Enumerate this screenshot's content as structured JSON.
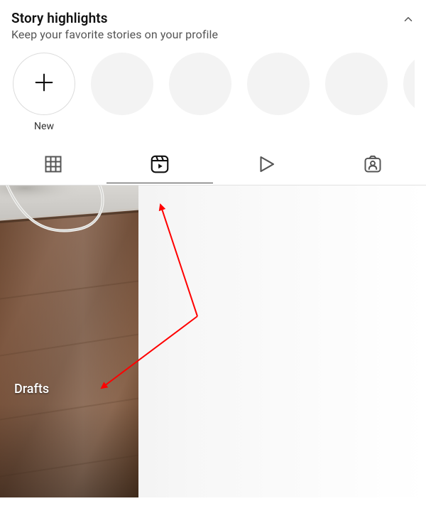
{
  "highlights": {
    "title": "Story highlights",
    "subtitle": "Keep your favorite stories on your profile",
    "new_label": "New"
  },
  "tabs": {
    "grid": "grid",
    "reels": "reels",
    "play": "play",
    "tagged": "tagged",
    "active": "reels"
  },
  "content": {
    "drafts_label": "Drafts"
  },
  "annotation": {
    "color": "#ff0000"
  }
}
